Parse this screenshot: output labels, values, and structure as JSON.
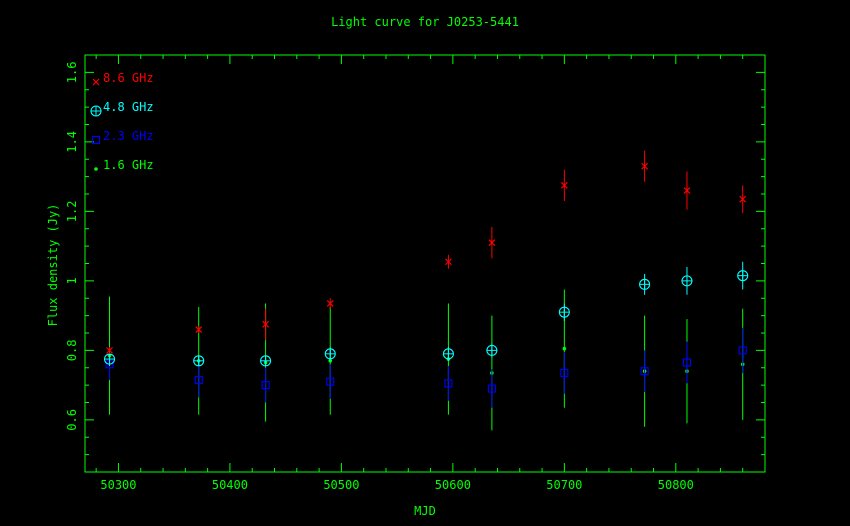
{
  "chart_data": {
    "type": "scatter",
    "title": "Light curve for J0253-5441",
    "xlabel": "MJD",
    "ylabel": "Flux density (Jy)",
    "xlim": [
      50270,
      50880
    ],
    "ylim": [
      0.45,
      1.65
    ],
    "x_ticks": [
      50300,
      50400,
      50500,
      50600,
      50700,
      50800
    ],
    "y_ticks": [
      0.6,
      0.8,
      1,
      1.2,
      1.4,
      1.6
    ],
    "y_tick_labels": [
      "0.6",
      "0.8",
      "1",
      "1.2",
      "1.4",
      "1.6"
    ],
    "grid": false,
    "legend_position": "top-left",
    "axis_color": "#00ff00",
    "series": [
      {
        "name": "8.6 GHz",
        "marker": "cross",
        "color": "#ff0000",
        "points": [
          {
            "x": 50292,
            "y": 0.8,
            "err": 0.01
          },
          {
            "x": 50372,
            "y": 0.86,
            "err": 0.01
          },
          {
            "x": 50432,
            "y": 0.875,
            "err": 0.045
          },
          {
            "x": 50490,
            "y": 0.935,
            "err": 0.015
          },
          {
            "x": 50596,
            "y": 1.055,
            "err": 0.02
          },
          {
            "x": 50635,
            "y": 1.11,
            "err": 0.045
          },
          {
            "x": 50700,
            "y": 1.275,
            "err": 0.045
          },
          {
            "x": 50772,
            "y": 1.33,
            "err": 0.045
          },
          {
            "x": 50810,
            "y": 1.26,
            "err": 0.055
          },
          {
            "x": 50860,
            "y": 1.235,
            "err": 0.04
          }
        ]
      },
      {
        "name": "4.8 GHz",
        "marker": "circle-plus",
        "color": "#00ffff",
        "points": [
          {
            "x": 50292,
            "y": 0.775,
            "err": 0.02
          },
          {
            "x": 50372,
            "y": 0.77,
            "err": 0.015
          },
          {
            "x": 50432,
            "y": 0.77,
            "err": 0.015
          },
          {
            "x": 50490,
            "y": 0.79,
            "err": 0.02
          },
          {
            "x": 50596,
            "y": 0.79,
            "err": 0.02
          },
          {
            "x": 50635,
            "y": 0.8,
            "err": 0.02
          },
          {
            "x": 50700,
            "y": 0.91,
            "err": 0.025
          },
          {
            "x": 50772,
            "y": 0.99,
            "err": 0.03
          },
          {
            "x": 50810,
            "y": 1.0,
            "err": 0.04
          },
          {
            "x": 50860,
            "y": 1.015,
            "err": 0.04
          }
        ]
      },
      {
        "name": "2.3 GHz",
        "marker": "square",
        "color": "#0000ff",
        "points": [
          {
            "x": 50292,
            "y": 0.76,
            "err": 0.045
          },
          {
            "x": 50372,
            "y": 0.715,
            "err": 0.05
          },
          {
            "x": 50432,
            "y": 0.7,
            "err": 0.05
          },
          {
            "x": 50490,
            "y": 0.71,
            "err": 0.05
          },
          {
            "x": 50596,
            "y": 0.705,
            "err": 0.05
          },
          {
            "x": 50635,
            "y": 0.69,
            "err": 0.055
          },
          {
            "x": 50700,
            "y": 0.735,
            "err": 0.06
          },
          {
            "x": 50772,
            "y": 0.74,
            "err": 0.06
          },
          {
            "x": 50810,
            "y": 0.765,
            "err": 0.06
          },
          {
            "x": 50860,
            "y": 0.8,
            "err": 0.065
          }
        ]
      },
      {
        "name": "1.6 GHz",
        "marker": "dot",
        "color": "#00ff00",
        "points": [
          {
            "x": 50292,
            "y": 0.785,
            "err": 0.17
          },
          {
            "x": 50372,
            "y": 0.77,
            "err": 0.155
          },
          {
            "x": 50432,
            "y": 0.765,
            "err": 0.17
          },
          {
            "x": 50490,
            "y": 0.77,
            "err": 0.155
          },
          {
            "x": 50596,
            "y": 0.775,
            "err": 0.16
          },
          {
            "x": 50635,
            "y": 0.735,
            "err": 0.165
          },
          {
            "x": 50700,
            "y": 0.805,
            "err": 0.17
          },
          {
            "x": 50772,
            "y": 0.74,
            "err": 0.16
          },
          {
            "x": 50810,
            "y": 0.74,
            "err": 0.15
          },
          {
            "x": 50860,
            "y": 0.76,
            "err": 0.16
          }
        ]
      }
    ]
  }
}
